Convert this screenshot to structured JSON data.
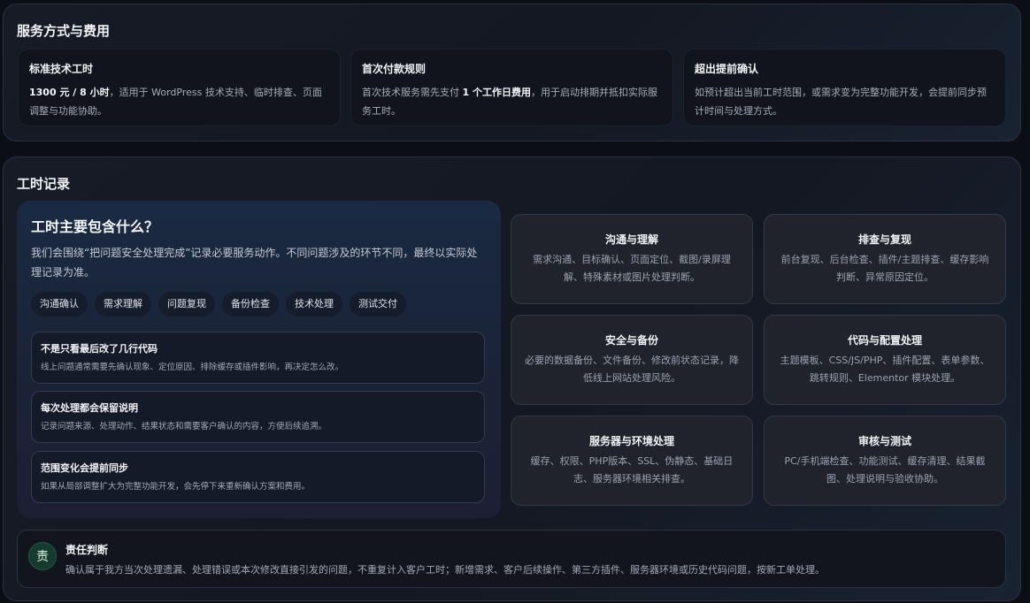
{
  "fees": {
    "title": "服务方式与费用",
    "cards": [
      {
        "title": "标准技术工时",
        "bold": "1300 元 / 8 小时",
        "text": "，适用于 WordPress 技术支持、临时排查、页面调整与功能协助。"
      },
      {
        "title": "首次付款规则",
        "pre": "首次技术服务需先支付 ",
        "bold": "1 个工作日费用",
        "text": "，用于启动排期并抵扣实际服务工时。"
      },
      {
        "title": "超出提前确认",
        "text": "如预计超出当前工时范围，或需求变为完整功能开发，会提前同步预计时间与处理方式。"
      }
    ]
  },
  "records": {
    "title": "工时记录",
    "info": {
      "heading": "工时主要包含什么？",
      "desc": "我们会围绕“把问题安全处理完成”记录必要服务动作。不同问题涉及的环节不同，最终以实际处理记录为准。",
      "tags": [
        "沟通确认",
        "需求理解",
        "问题复现",
        "备份检查",
        "技术处理",
        "测试交付"
      ],
      "notes": [
        {
          "title": "不是只看最后改了几行代码",
          "text": "线上问题通常需要先确认现象、定位原因、排除缓存或插件影响，再决定怎么改。"
        },
        {
          "title": "每次处理都会保留说明",
          "text": "记录问题来源、处理动作、结果状态和需要客户确认的内容，方便后续追溯。"
        },
        {
          "title": "范围变化会提前同步",
          "text": "如果从局部调整扩大为完整功能开发，会先停下来重新确认方案和费用。"
        }
      ]
    },
    "cards": [
      {
        "title": "沟通与理解",
        "text": "需求沟通、目标确认、页面定位、截图/录屏理解、特殊素材或图片处理判断。"
      },
      {
        "title": "排查与复现",
        "text": "前台复现、后台检查、插件/主题排查、缓存影响判断、异常原因定位。"
      },
      {
        "title": "安全与备份",
        "text": "必要的数据备份、文件备份、修改前状态记录，降低线上网站处理风险。"
      },
      {
        "title": "代码与配置处理",
        "text": "主题模板、CSS/JS/PHP、插件配置、表单参数、跳转规则、Elementor 模块处理。"
      },
      {
        "title": "服务器与环境处理",
        "text": "缓存、权限、PHP版本、SSL、伪静态、基础日志、服务器环境相关排查。"
      },
      {
        "title": "审核与测试",
        "text": "PC/手机端检查、功能测试、缓存清理、结果截图、处理说明与验收协助。"
      }
    ],
    "responsibility": {
      "icon": "责",
      "title": "责任判断",
      "text": "确认属于我方当次处理遗漏、处理错误或本次修改直接引发的问题，不重复计入客户工时；新增需求、客户后续操作、第三方插件、服务器环境或历史代码问题，按新工单处理。"
    }
  }
}
